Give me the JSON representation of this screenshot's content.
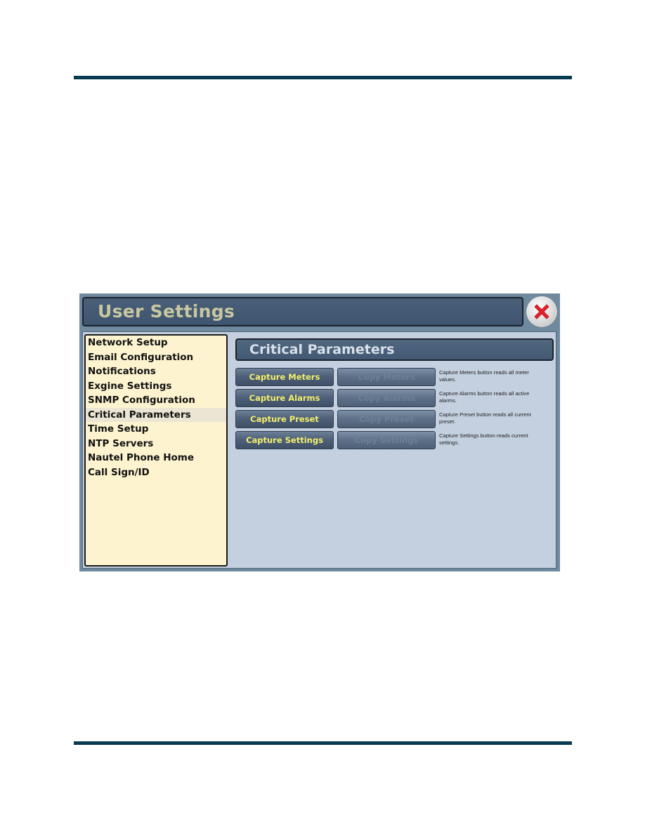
{
  "window": {
    "title": "User Settings",
    "close_icon": "close-x-icon"
  },
  "menu": {
    "items": [
      {
        "label": "Network Setup"
      },
      {
        "label": "Email Configuration"
      },
      {
        "label": "Notifications"
      },
      {
        "label": "Exgine Settings"
      },
      {
        "label": "SNMP Configuration"
      },
      {
        "label": "Critical Parameters",
        "selected": true
      },
      {
        "label": "Time Setup"
      },
      {
        "label": "NTP Servers"
      },
      {
        "label": "Nautel Phone Home"
      },
      {
        "label": "Call Sign/ID"
      }
    ]
  },
  "main": {
    "section_title": "Critical Parameters",
    "rows": [
      {
        "capture_label": "Capture Meters",
        "copy_label": "Copy Meters",
        "description": "Capture Meters button reads all meter values."
      },
      {
        "capture_label": "Capture Alarms",
        "copy_label": "Copy Alarms",
        "description": "Capture Alarms button reads all active alarms."
      },
      {
        "capture_label": "Capture Preset",
        "copy_label": "Copy Preset",
        "description": "Capture Preset button reads all current preset."
      },
      {
        "capture_label": "Capture Settings",
        "copy_label": "Copy Settings",
        "description": "Capture Settings button reads current settings."
      }
    ]
  },
  "colors": {
    "rule": "#063a50",
    "title_text": "#c9c7a0",
    "capture_text": "#f4ef6e",
    "menu_bg": "#fdf3cf"
  }
}
